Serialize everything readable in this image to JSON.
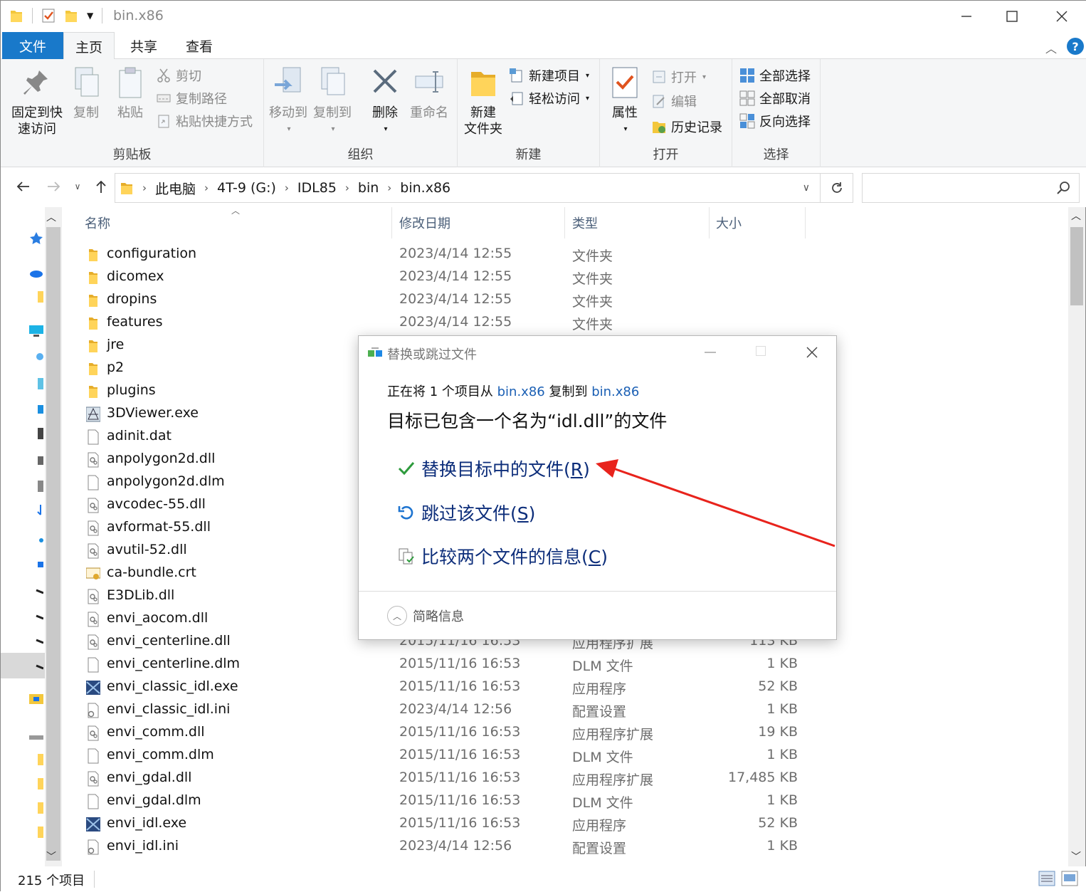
{
  "window": {
    "title": "bin.x86"
  },
  "tabs": {
    "file": "文件",
    "home": "主页",
    "share": "共享",
    "view": "查看"
  },
  "ribbon": {
    "clipboard": {
      "label": "剪贴板",
      "pin_line1": "固定到快",
      "pin_line2": "速访问",
      "copy": "复制",
      "paste": "粘贴",
      "cut": "剪切",
      "copy_path": "复制路径",
      "paste_shortcut": "粘贴快捷方式"
    },
    "organize": {
      "label": "组织",
      "move_to": "移动到",
      "copy_to": "复制到",
      "delete": "删除",
      "rename": "重命名"
    },
    "new": {
      "label": "新建",
      "new_folder_line1": "新建",
      "new_folder_line2": "文件夹",
      "new_item": "新建项目",
      "easy_access": "轻松访问"
    },
    "open": {
      "label": "打开",
      "properties": "属性",
      "open": "打开",
      "edit": "编辑",
      "history": "历史记录"
    },
    "select": {
      "label": "选择",
      "select_all": "全部选择",
      "select_none": "全部取消",
      "invert": "反向选择"
    }
  },
  "address": {
    "crumbs": [
      "此电脑",
      "4T-9 (G:)",
      "IDL85",
      "bin",
      "bin.x86"
    ],
    "search_placeholder": ""
  },
  "columns": {
    "name": "名称",
    "date": "修改日期",
    "type": "类型",
    "size": "大小"
  },
  "files": [
    {
      "name": "configuration",
      "date": "2023/4/14 12:55",
      "type": "文件夹",
      "size": "",
      "icon": "folder"
    },
    {
      "name": "dicomex",
      "date": "2023/4/14 12:55",
      "type": "文件夹",
      "size": "",
      "icon": "folder"
    },
    {
      "name": "dropins",
      "date": "2023/4/14 12:55",
      "type": "文件夹",
      "size": "",
      "icon": "folder"
    },
    {
      "name": "features",
      "date": "2023/4/14 12:55",
      "type": "文件夹",
      "size": "",
      "icon": "folder"
    },
    {
      "name": "jre",
      "date": "",
      "type": "",
      "size": "",
      "icon": "folder"
    },
    {
      "name": "p2",
      "date": "",
      "type": "",
      "size": "",
      "icon": "folder"
    },
    {
      "name": "plugins",
      "date": "",
      "type": "",
      "size": "",
      "icon": "folder"
    },
    {
      "name": "3DViewer.exe",
      "date": "",
      "type": "",
      "size": "",
      "icon": "exe3d"
    },
    {
      "name": "adinit.dat",
      "date": "",
      "type": "",
      "size": "",
      "icon": "blank"
    },
    {
      "name": "anpolygon2d.dll",
      "date": "",
      "type": "",
      "size": "",
      "icon": "dll"
    },
    {
      "name": "anpolygon2d.dlm",
      "date": "",
      "type": "",
      "size": "",
      "icon": "blank"
    },
    {
      "name": "avcodec-55.dll",
      "date": "",
      "type": "",
      "size": "",
      "icon": "dll"
    },
    {
      "name": "avformat-55.dll",
      "date": "",
      "type": "",
      "size": "",
      "icon": "dll"
    },
    {
      "name": "avutil-52.dll",
      "date": "",
      "type": "",
      "size": "",
      "icon": "dll"
    },
    {
      "name": "ca-bundle.crt",
      "date": "",
      "type": "",
      "size": "",
      "icon": "cert"
    },
    {
      "name": "E3DLib.dll",
      "date": "",
      "type": "",
      "size": "",
      "icon": "dll"
    },
    {
      "name": "envi_aocom.dll",
      "date": "",
      "type": "",
      "size": "",
      "icon": "dll"
    },
    {
      "name": "envi_centerline.dll",
      "date": "2015/11/16 16:53",
      "type": "应用程序扩展",
      "size": "113 KB",
      "icon": "dll"
    },
    {
      "name": "envi_centerline.dlm",
      "date": "2015/11/16 16:53",
      "type": "DLM 文件",
      "size": "1 KB",
      "icon": "blank"
    },
    {
      "name": "envi_classic_idl.exe",
      "date": "2015/11/16 16:53",
      "type": "应用程序",
      "size": "52 KB",
      "icon": "envi"
    },
    {
      "name": "envi_classic_idl.ini",
      "date": "2023/4/14 12:56",
      "type": "配置设置",
      "size": "1 KB",
      "icon": "ini"
    },
    {
      "name": "envi_comm.dll",
      "date": "2015/11/16 16:53",
      "type": "应用程序扩展",
      "size": "19 KB",
      "icon": "dll"
    },
    {
      "name": "envi_comm.dlm",
      "date": "2015/11/16 16:53",
      "type": "DLM 文件",
      "size": "1 KB",
      "icon": "blank"
    },
    {
      "name": "envi_gdal.dll",
      "date": "2015/11/16 16:53",
      "type": "应用程序扩展",
      "size": "17,485 KB",
      "icon": "dll"
    },
    {
      "name": "envi_gdal.dlm",
      "date": "2015/11/16 16:53",
      "type": "DLM 文件",
      "size": "1 KB",
      "icon": "blank"
    },
    {
      "name": "envi_idl.exe",
      "date": "2015/11/16 16:53",
      "type": "应用程序",
      "size": "52 KB",
      "icon": "envi"
    },
    {
      "name": "envi_idl.ini",
      "date": "2023/4/14 12:56",
      "type": "配置设置",
      "size": "1 KB",
      "icon": "ini"
    }
  ],
  "status": {
    "count": "215 个项目"
  },
  "dialog": {
    "title": "替换或跳过文件",
    "line_pre": "正在将 1 个项目从 ",
    "src": "bin.x86",
    "line_mid": " 复制到 ",
    "dst": "bin.x86",
    "heading": "目标已包含一个名为“idl.dll”的文件",
    "replace_text": "替换目标中的文件(",
    "replace_key": "R",
    "skip_text": "跳过该文件(",
    "skip_key": "S",
    "compare_text": "比较两个文件的信息(",
    "compare_key": "C",
    "close_paren": ")",
    "details": "简略信息"
  },
  "colors": {
    "accent": "#1979ca",
    "link": "#1a5fb4",
    "option_text": "#0c2d7a",
    "annotation_arrow": "#e8231c"
  }
}
